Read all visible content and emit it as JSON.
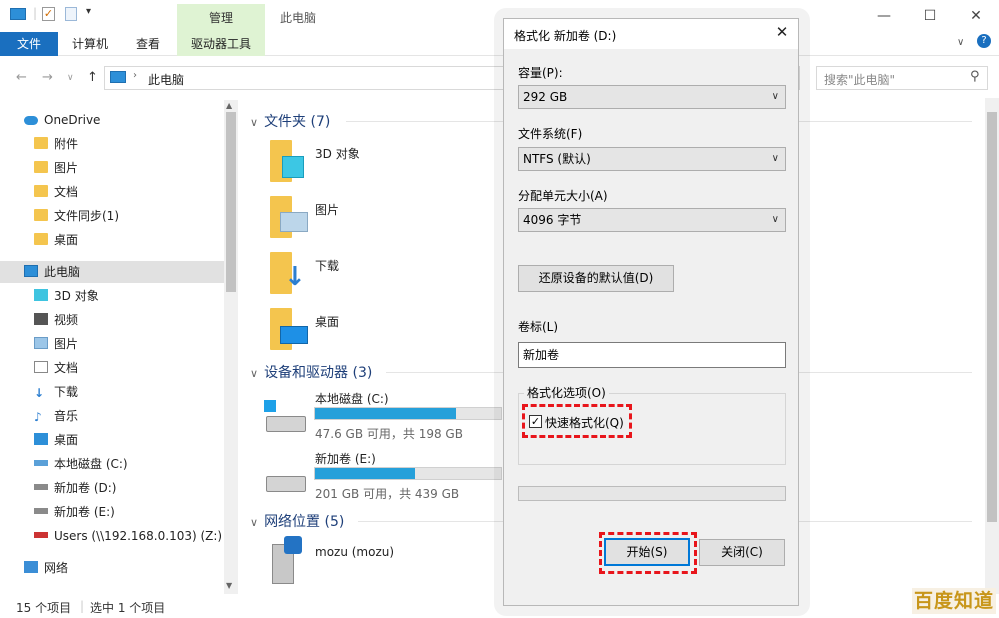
{
  "window": {
    "title": "此电脑",
    "context_tab": "管理",
    "controls": {
      "minimize": "—",
      "maximize": "☐",
      "close": "✕"
    }
  },
  "ribbon": {
    "tabs": [
      "文件",
      "计算机",
      "查看",
      "驱动器工具"
    ]
  },
  "address": {
    "path": "此电脑",
    "search_placeholder": "搜索\"此电脑\""
  },
  "nav": {
    "quick": [
      {
        "label": "OneDrive",
        "icon": "cloud-icon"
      },
      {
        "label": "附件",
        "icon": "folder-icon"
      },
      {
        "label": "图片",
        "icon": "folder-icon"
      },
      {
        "label": "文档",
        "icon": "folder-icon"
      },
      {
        "label": "文件同步(1)",
        "icon": "folder-icon"
      },
      {
        "label": "桌面",
        "icon": "folder-icon"
      }
    ],
    "thispc": {
      "label": "此电脑",
      "icon": "computer-icon"
    },
    "pc_items": [
      {
        "label": "3D 对象",
        "icon": "cube-icon"
      },
      {
        "label": "视频",
        "icon": "video-icon"
      },
      {
        "label": "图片",
        "icon": "pictures-icon"
      },
      {
        "label": "文档",
        "icon": "document-icon"
      },
      {
        "label": "下载",
        "icon": "download-icon"
      },
      {
        "label": "音乐",
        "icon": "music-icon"
      },
      {
        "label": "桌面",
        "icon": "desktop-icon"
      },
      {
        "label": "本地磁盘 (C:)",
        "icon": "drive-icon"
      },
      {
        "label": "新加卷 (D:)",
        "icon": "drive-icon"
      },
      {
        "label": "新加卷 (E:)",
        "icon": "drive-icon"
      },
      {
        "label": "Users (\\\\192.168.0.103) (Z:)",
        "icon": "network-drive-icon"
      }
    ],
    "network": {
      "label": "网络",
      "icon": "network-icon"
    }
  },
  "content": {
    "groups": {
      "folders": "文件夹 (7)",
      "devices": "设备和驱动器 (3)",
      "network": "网络位置 (5)"
    },
    "folders": [
      "3D 对象",
      "图片",
      "下载",
      "桌面"
    ],
    "drives": [
      {
        "name": "本地磁盘 (C:)",
        "info": "47.6 GB 可用，共 198 GB",
        "used_fraction": 0.76
      },
      {
        "name": "新加卷 (E:)",
        "info": "201 GB 可用，共 439 GB",
        "used_fraction": 0.54
      }
    ],
    "network_locations": [
      "mozu (mozu)"
    ]
  },
  "status": {
    "count": "15 个项目",
    "selected": "选中 1 个项目"
  },
  "dialog": {
    "title": "格式化 新加卷 (D:)",
    "capacity_label": "容量(P):",
    "capacity_value": "292 GB",
    "fs_label": "文件系统(F)",
    "fs_value": "NTFS (默认)",
    "alloc_label": "分配单元大小(A)",
    "alloc_value": "4096 字节",
    "restore_button": "还原设备的默认值(D)",
    "volume_label": "卷标(L)",
    "volume_value": "新加卷",
    "options_label": "格式化选项(O)",
    "quick_format_label": "快速格式化(Q)",
    "quick_format_checked": true,
    "start_button": "开始(S)",
    "close_button": "关闭(C)"
  },
  "watermark": "百度知道"
}
